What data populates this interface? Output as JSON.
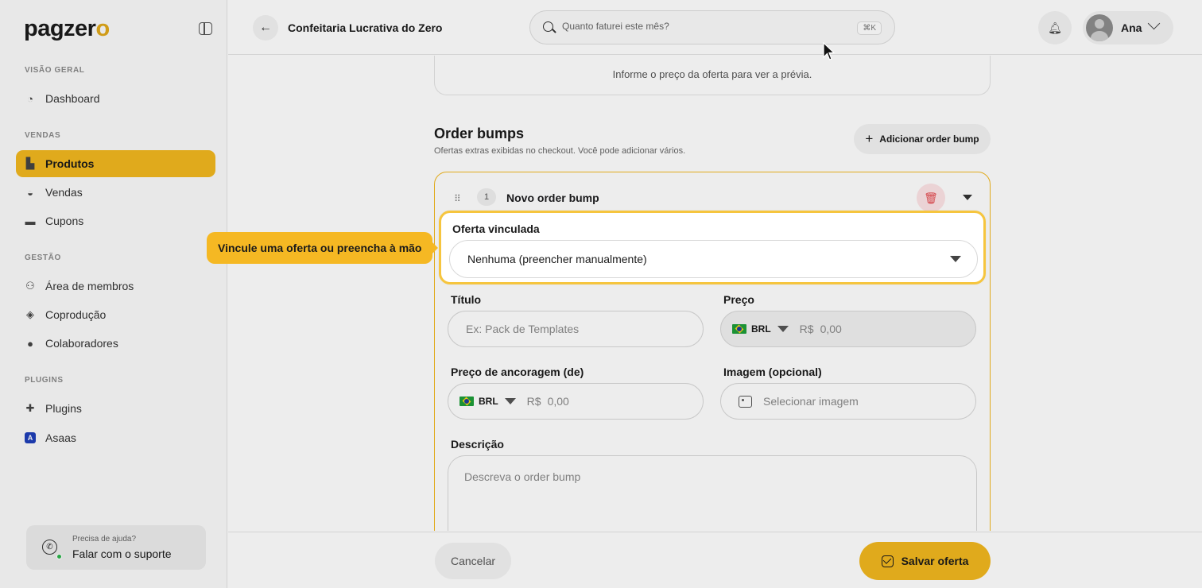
{
  "brand": {
    "logo_main": "pagzer",
    "logo_accent": "o",
    "accent_color": "#f2b71f"
  },
  "sidebar": {
    "sections": [
      {
        "label": "VISÃO GERAL",
        "items": [
          {
            "label": "Dashboard",
            "icon": "dashboard-icon"
          }
        ]
      },
      {
        "label": "VENDAS",
        "items": [
          {
            "label": "Produtos",
            "icon": "products-icon",
            "active": true
          },
          {
            "label": "Vendas",
            "icon": "sales-icon"
          },
          {
            "label": "Cupons",
            "icon": "coupon-icon"
          }
        ]
      },
      {
        "label": "GESTÃO",
        "items": [
          {
            "label": "Área de membros",
            "icon": "members-icon"
          },
          {
            "label": "Coprodução",
            "icon": "handshake-icon"
          },
          {
            "label": "Colaboradores",
            "icon": "user-icon"
          }
        ]
      },
      {
        "label": "PLUGINS",
        "items": [
          {
            "label": "Plugins",
            "icon": "puzzle-icon"
          },
          {
            "label": "Asaas",
            "icon": "asaas-icon",
            "icon_letter": "A"
          }
        ]
      }
    ],
    "help": {
      "caption": "Precisa de ajuda?",
      "link": "Falar com o suporte"
    }
  },
  "header": {
    "title": "Confeitaria Lucrativa do Zero",
    "search_placeholder": "Quanto faturei este mês?",
    "search_shortcut": "⌘K",
    "user_name": "Ana"
  },
  "main": {
    "preview_text": "Informe o preço da oferta para ver a prévia.",
    "order_bumps_title": "Order bumps",
    "order_bumps_subtitle": "Ofertas extras exibidas no checkout. Você pode adicionar vários.",
    "add_bump_label": "Adicionar order bump",
    "bump": {
      "index": "1",
      "name": "Novo order bump",
      "linked_offer_label": "Oferta vinculada",
      "linked_offer_value": "Nenhuma (preencher manualmente)",
      "title_label": "Título",
      "title_placeholder": "Ex: Pack de Templates",
      "price_label": "Preço",
      "price_currency": "BRL",
      "price_symbol": "R$",
      "price_placeholder": "0,00",
      "anchor_label": "Preço de ancoragem (de)",
      "anchor_currency": "BRL",
      "anchor_symbol": "R$",
      "anchor_placeholder": "0,00",
      "image_label": "Imagem (opcional)",
      "image_placeholder": "Selecionar imagem",
      "description_label": "Descrição",
      "description_placeholder": "Descreva o order bump"
    }
  },
  "tooltip": {
    "text": "Vincule uma oferta ou preencha à mão"
  },
  "footer": {
    "cancel_label": "Cancelar",
    "save_label": "Salvar oferta"
  }
}
